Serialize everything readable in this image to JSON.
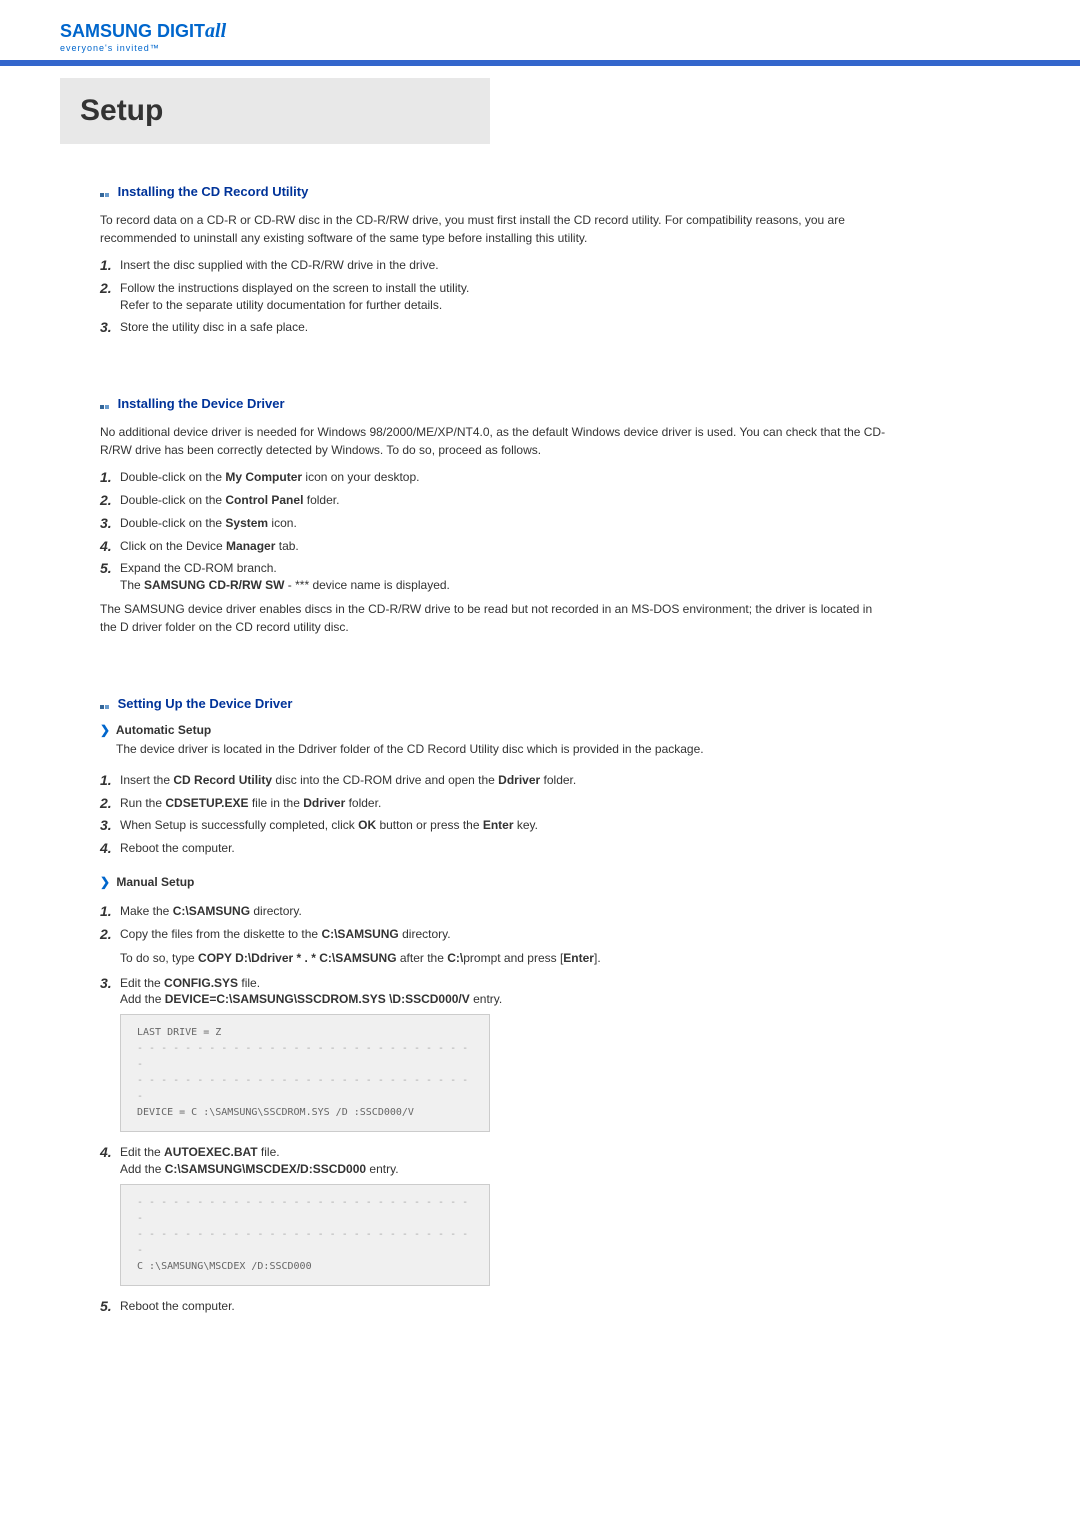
{
  "logo": {
    "brand_samsung": "SAMSUNG",
    "brand_digit": " DIGIT",
    "brand_ital": "all",
    "tagline": "everyone's invited™"
  },
  "page_title": "Setup",
  "sections": {
    "install_cd": {
      "title": "Installing the CD Record Utility",
      "desc": "To record data on a CD-R or CD-RW disc in the CD-R/RW drive, you must first install the CD record utility. For compatibility reasons, you are recommended to uninstall any existing software of the same type before installing this utility.",
      "steps": [
        "Insert the disc supplied with the CD-R/RW drive in the drive.",
        "Follow the instructions displayed on the screen to install the utility.\nRefer to the separate utility documentation for further details.",
        "Store the utility disc in a safe place."
      ]
    },
    "install_driver": {
      "title": "Installing the Device Driver",
      "desc": "No additional device driver is needed for Windows 98/2000/ME/XP/NT4.0, as the default Windows device driver is used. You can check that the CD-R/RW drive has been correctly detected by Windows. To do so, proceed as follows.",
      "steps": [
        {
          "pre": "Double-click on the ",
          "bold": "My Computer",
          "post": " icon on your desktop."
        },
        {
          "pre": "Double-click on the ",
          "bold": "Control Panel",
          "post": " folder."
        },
        {
          "pre": "Double-click on the ",
          "bold": "System",
          "post": " icon."
        },
        {
          "pre": "Click on the Device ",
          "bold": "Manager",
          "post": " tab."
        },
        {
          "line1": "Expand the CD-ROM branch.",
          "line2_pre": "The ",
          "line2_bold": "SAMSUNG CD-R/RW SW",
          "line2_post": " - *** device name is displayed."
        }
      ],
      "footer": "The SAMSUNG device driver enables discs in the CD-R/RW drive to be read but not recorded in an MS-DOS environment; the driver is located in the D driver folder on the CD record utility disc."
    },
    "setup_driver": {
      "title": "Setting Up the Device Driver",
      "auto": {
        "label": "Automatic Setup",
        "desc": "The device driver is located in the Ddriver folder of the CD Record Utility disc which is provided in the package.",
        "steps": [
          {
            "pre": "Insert the ",
            "bold1": "CD Record Utility",
            "mid": " disc into the CD-ROM drive and open the ",
            "bold2": "Ddriver",
            "post": " folder."
          },
          {
            "pre": "Run the ",
            "bold1": "CDSETUP.EXE",
            "mid": " file in the ",
            "bold2": "Ddriver",
            "post": " folder."
          },
          {
            "pre": "When Setup is successfully completed, click ",
            "bold1": "OK",
            "mid": " button or press the ",
            "bold2": "Enter",
            "post": " key."
          },
          {
            "text": "Reboot the computer."
          }
        ]
      },
      "manual": {
        "label": "Manual Setup",
        "step1": {
          "pre": "Make the ",
          "bold": "C:\\SAMSUNG",
          "post": " directory."
        },
        "step2": {
          "pre": "Copy the files from the diskette to the ",
          "bold": "C:\\SAMSUNG",
          "post": " directory.",
          "detail_pre": "To do so, type ",
          "detail_b1": "COPY D:\\Ddriver * . * C:\\SAMSUNG",
          "detail_mid": " after the ",
          "detail_b2": "C:\\",
          "detail_post": "prompt and press [",
          "detail_b3": "Enter",
          "detail_close": "]."
        },
        "step3": {
          "l1_pre": "Edit the ",
          "l1_bold": "CONFIG.SYS",
          "l1_post": " file.",
          "l2_pre": "Add the ",
          "l2_bold": "DEVICE=C:\\SAMSUNG\\SSCDROM.SYS \\D:SSCD000/V",
          "l2_post": " entry.",
          "code1": "LAST DRIVE = Z",
          "code2": "DEVICE = C :\\SAMSUNG\\SSCDROM.SYS /D :SSCD000/V"
        },
        "step4": {
          "l1_pre": "Edit the ",
          "l1_bold": "AUTOEXEC.BAT",
          "l1_post": " file.",
          "l2_pre": "Add the ",
          "l2_bold": "C:\\SAMSUNG\\MSCDEX/D:SSCD000",
          "l2_post": " entry.",
          "code": "C :\\SAMSUNG\\MSCDEX /D:SSCD000"
        },
        "step5": "Reboot the computer."
      }
    }
  }
}
